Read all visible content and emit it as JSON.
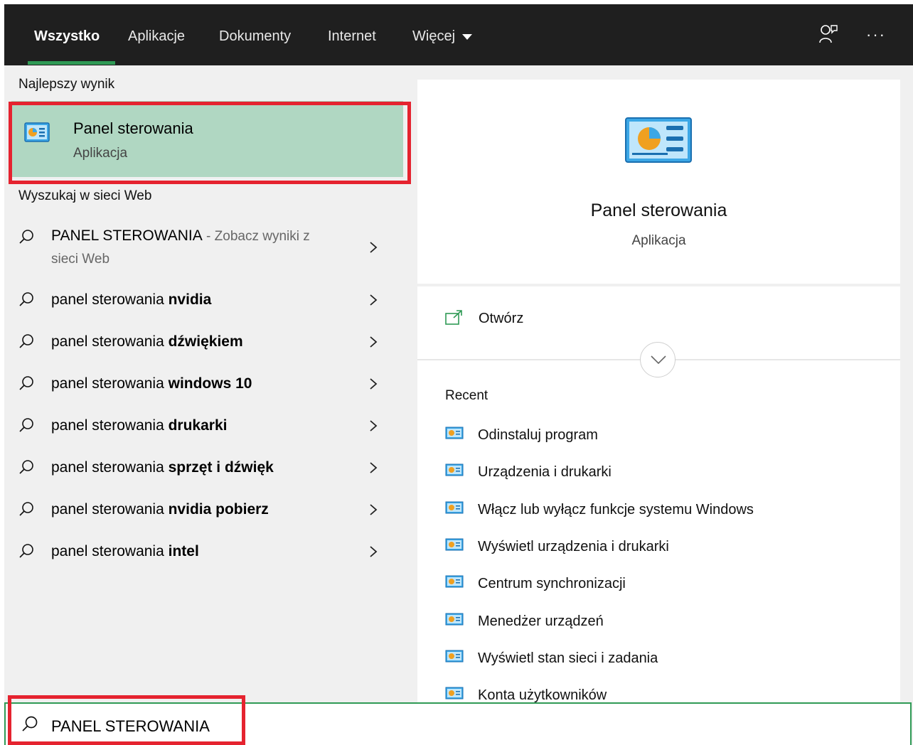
{
  "tabs": [
    {
      "label": "Wszystko",
      "active": true
    },
    {
      "label": "Aplikacje"
    },
    {
      "label": "Dokumenty"
    },
    {
      "label": "Internet"
    },
    {
      "label": "Więcej"
    }
  ],
  "topbar_icons": [
    "feedback-icon",
    "more-icon"
  ],
  "more_label": "···",
  "best_match": {
    "section_title": "Najlepszy wynik",
    "title": "Panel sterowania",
    "subtitle": "Aplikacja"
  },
  "web_search": {
    "section_title": "Wyszukaj w sieci Web",
    "first": {
      "query": "PANEL STEROWANIA",
      "hint": " - Zobacz wyniki z",
      "hint2": "sieci Web"
    },
    "items": [
      {
        "prefix": "panel sterowania ",
        "bold": "nvidia"
      },
      {
        "prefix": "panel sterowania ",
        "bold": "dźwiękiem"
      },
      {
        "prefix": "panel sterowania ",
        "bold": "windows 10"
      },
      {
        "prefix": "panel sterowania ",
        "bold": "drukarki"
      },
      {
        "prefix": "panel sterowania ",
        "bold": "sprzęt i dźwięk"
      },
      {
        "prefix": "panel sterowania ",
        "bold": "nvidia pobierz"
      },
      {
        "prefix": "panel sterowania ",
        "bold": "intel"
      }
    ]
  },
  "preview": {
    "app_name": "Panel sterowania",
    "app_type": "Aplikacja",
    "open_label": "Otwórz",
    "recent_title": "Recent",
    "recent": [
      "Odinstaluj program",
      "Urządzenia i drukarki",
      "Włącz lub wyłącz funkcje systemu Windows",
      "Wyświetl urządzenia i drukarki",
      "Centrum synchronizacji",
      "Menedżer urządzeń",
      "Wyświetl stan sieci i zadania",
      "Konta użytkowników"
    ]
  },
  "search": {
    "value": "PANEL STEROWANIA"
  },
  "colors": {
    "accent": "#2f9a55",
    "highlight": "#e5232f",
    "best_bg": "#b0d7c2",
    "topbar": "#1f1f1f"
  }
}
